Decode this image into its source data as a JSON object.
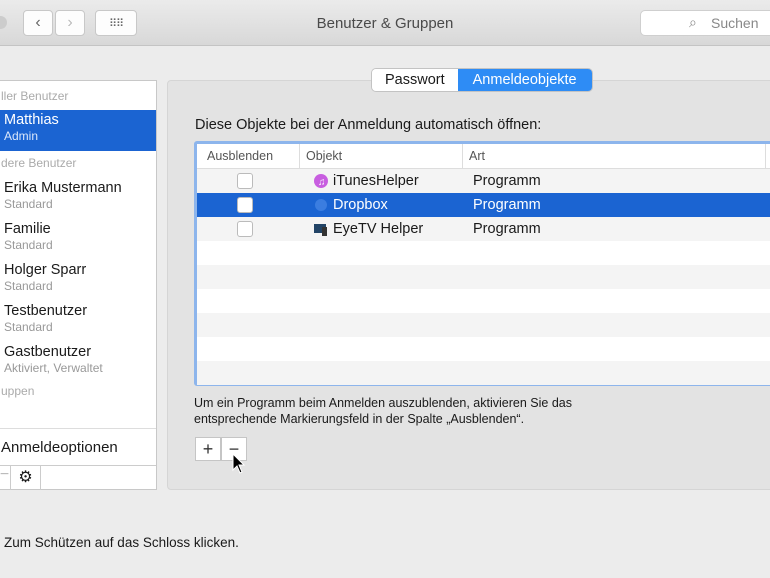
{
  "window": {
    "title": "Benutzer & Gruppen",
    "search_placeholder": "Suchen"
  },
  "sidebar": {
    "current_header": "ller Benutzer",
    "current_user": {
      "name": "Matthias",
      "role": "Admin"
    },
    "others_header": "dere Benutzer",
    "users": [
      {
        "name": "Erika Mustermann",
        "role": "Standard"
      },
      {
        "name": "Familie",
        "role": "Standard"
      },
      {
        "name": "Holger Sparr",
        "role": "Standard"
      },
      {
        "name": "Testbenutzer",
        "role": "Standard"
      },
      {
        "name": "Gastbenutzer",
        "role": "Aktiviert, Verwaltet"
      }
    ],
    "groups_header": "uppen",
    "login_options": "Anmeldeoptionen",
    "remove": "−"
  },
  "tabs": [
    {
      "label": "Passwort"
    },
    {
      "label": "Anmeldeobjekte",
      "active": true
    }
  ],
  "main": {
    "label": "Diese Objekte bei der Anmeldung automatisch öffnen:",
    "columns": [
      "Ausblenden",
      "Objekt",
      "Art"
    ],
    "rows": [
      {
        "name": "iTunesHelper",
        "type": "Programm"
      },
      {
        "name": "Dropbox",
        "type": "Programm",
        "selected": true
      },
      {
        "name": "EyeTV Helper",
        "type": "Programm"
      }
    ],
    "help_line1": "Um ein Programm beim Anmelden auszublenden, aktivieren Sie das",
    "help_line2": "entsprechende Markierungsfeld in der Spalte „Ausblenden“.",
    "add": "+",
    "remove": "−"
  },
  "footer": {
    "lock_text": "Zum Schützen auf das Schloss klicken."
  }
}
